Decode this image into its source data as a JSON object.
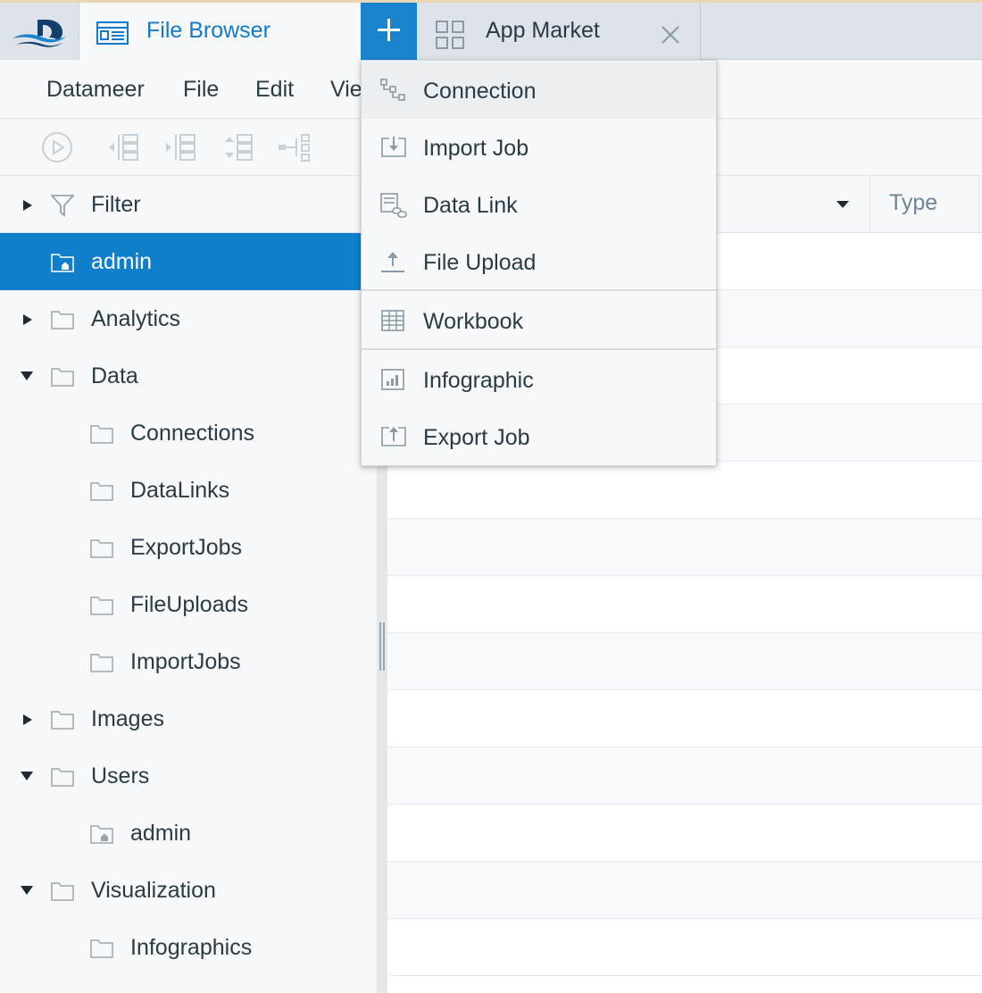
{
  "tabs": {
    "file_browser": "File Browser",
    "app_market": "App Market"
  },
  "menubar": {
    "items": [
      "Datameer",
      "File",
      "Edit",
      "Vie"
    ]
  },
  "sidebar": {
    "filter_label": "Filter",
    "tree": [
      {
        "label": "admin",
        "icon": "home-folder-icon",
        "level": 0,
        "arrow": "none",
        "selected": true
      },
      {
        "label": "Analytics",
        "icon": "folder-icon",
        "level": 0,
        "arrow": "collapsed"
      },
      {
        "label": "Data",
        "icon": "folder-icon",
        "level": 0,
        "arrow": "expanded"
      },
      {
        "label": "Connections",
        "icon": "folder-icon",
        "level": 1,
        "arrow": "none"
      },
      {
        "label": "DataLinks",
        "icon": "folder-icon",
        "level": 1,
        "arrow": "none"
      },
      {
        "label": "ExportJobs",
        "icon": "folder-icon",
        "level": 1,
        "arrow": "none"
      },
      {
        "label": "FileUploads",
        "icon": "folder-icon",
        "level": 1,
        "arrow": "none"
      },
      {
        "label": "ImportJobs",
        "icon": "folder-icon",
        "level": 1,
        "arrow": "none"
      },
      {
        "label": "Images",
        "icon": "folder-icon",
        "level": 0,
        "arrow": "collapsed"
      },
      {
        "label": "Users",
        "icon": "folder-icon",
        "level": 0,
        "arrow": "expanded"
      },
      {
        "label": "admin",
        "icon": "home-folder-icon",
        "level": 1,
        "arrow": "none"
      },
      {
        "label": "Visualization",
        "icon": "folder-icon",
        "level": 0,
        "arrow": "expanded"
      },
      {
        "label": "Infographics",
        "icon": "folder-icon",
        "level": 1,
        "arrow": "none"
      }
    ]
  },
  "main": {
    "type_header": "Type"
  },
  "dropdown": {
    "items": [
      {
        "label": "Connection",
        "icon": "connection-icon"
      },
      {
        "label": "Import Job",
        "icon": "import-job-icon"
      },
      {
        "label": "Data Link",
        "icon": "data-link-icon"
      },
      {
        "label": "File Upload",
        "icon": "file-upload-icon"
      },
      {
        "label": "Workbook",
        "icon": "workbook-icon"
      },
      {
        "label": "Infographic",
        "icon": "infographic-icon"
      },
      {
        "label": "Export Job",
        "icon": "export-job-icon"
      }
    ]
  },
  "colors": {
    "accent": "#1b84cf",
    "selected_row": "#0f7fcc",
    "tab_active_text": "#1479c9"
  }
}
